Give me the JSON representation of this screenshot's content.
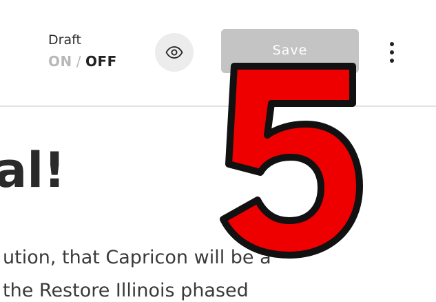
{
  "toolbar": {
    "draft_label": "Draft",
    "draft_on": "ON",
    "draft_separator": "/",
    "draft_off": "OFF",
    "preview_icon": "eye-icon",
    "save_label": "Save",
    "more_icon": "kebab-menu-icon"
  },
  "content": {
    "heading_fragment": "al!",
    "paragraph_lines": [
      "ution, that Capricon will be a",
      "the Restore Illinois phased"
    ]
  },
  "overlay": {
    "number": "5",
    "fill_color": "#ee0000",
    "stroke_color": "#111111"
  },
  "colors": {
    "save_button_disabled": "#c4c4c4",
    "divider": "#e2e2e2",
    "preview_button_bg": "#ececec"
  }
}
